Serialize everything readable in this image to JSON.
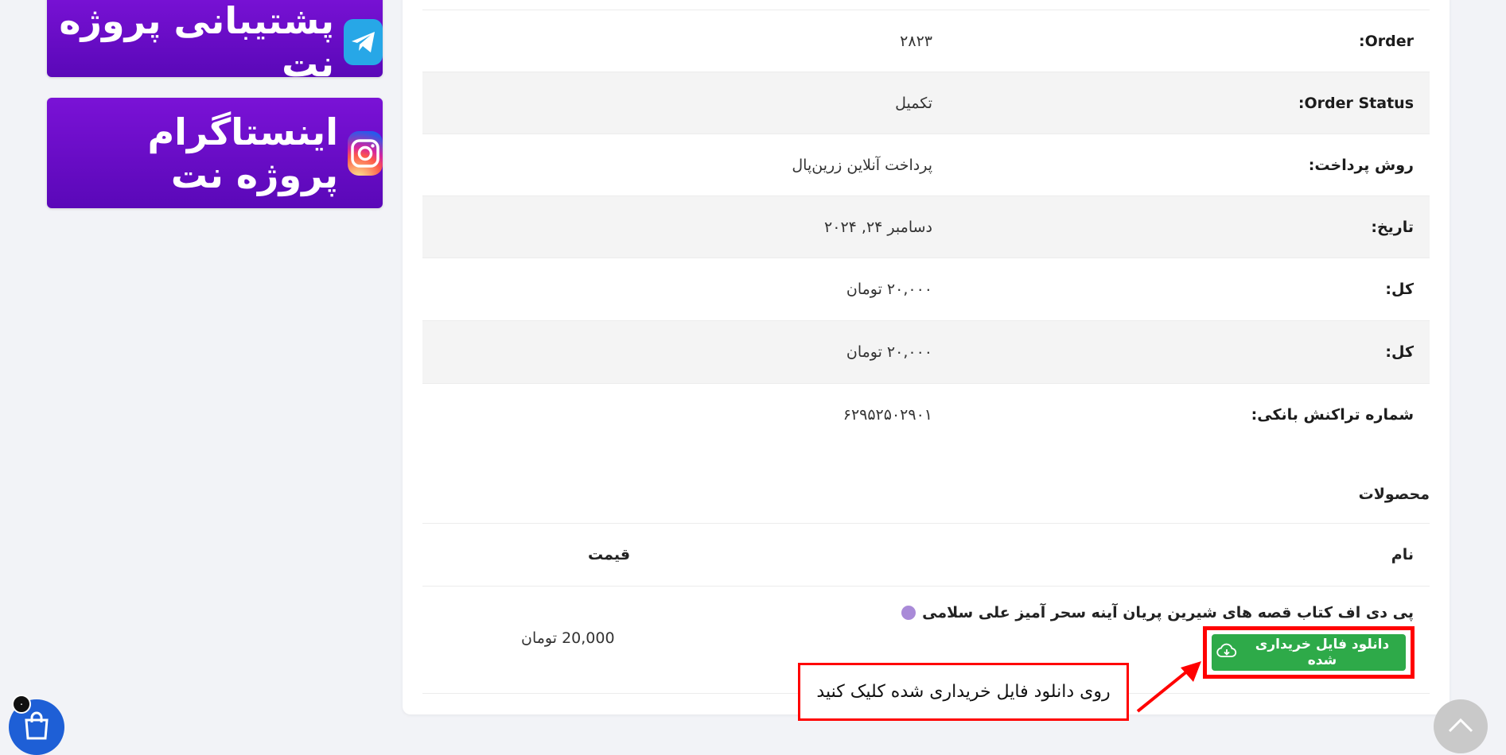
{
  "sidebar": {
    "telegram_banner_text": "پشتیبانی پروژه نت",
    "instagram_banner_text": "اینستاگرام پروژه نت"
  },
  "order": {
    "rows": [
      {
        "label": "Order:",
        "value": "۲۸۲۳"
      },
      {
        "label": "Order Status:",
        "value": "تکمیل"
      },
      {
        "label": "روش پرداخت:",
        "value": "پرداخت آنلاین زرین‌پال"
      },
      {
        "label": "تاریخ:",
        "value": "دسامبر ۲۴, ۲۰۲۴"
      },
      {
        "label": "کل:",
        "value": "۲۰,۰۰۰ تومان"
      },
      {
        "label": "کل:",
        "value": "۲۰,۰۰۰ تومان"
      },
      {
        "label": "شماره تراکنش بانکی:",
        "value": "۶۲۹۵۲۵۰۲۹۰۱"
      }
    ]
  },
  "products": {
    "title": "محصولات",
    "col_name": "نام",
    "col_price": "قیمت",
    "item_name": "پی دی اف کتاب قصه های شیرین پریان آینه سحر آمیز علی سلامی",
    "item_price": "20,000 تومان",
    "download_label": "دانلود فایل خریداری شده"
  },
  "annotation": {
    "callout_text": "روی دانلود فایل خریداری شده کلیک کنید",
    "highlight_color": "#ff0000"
  },
  "cart": {
    "count": "۰"
  },
  "colors": {
    "banner_purple": "#6a0fc8",
    "download_green": "#2eaa49",
    "cart_blue": "#1e5fd6"
  }
}
